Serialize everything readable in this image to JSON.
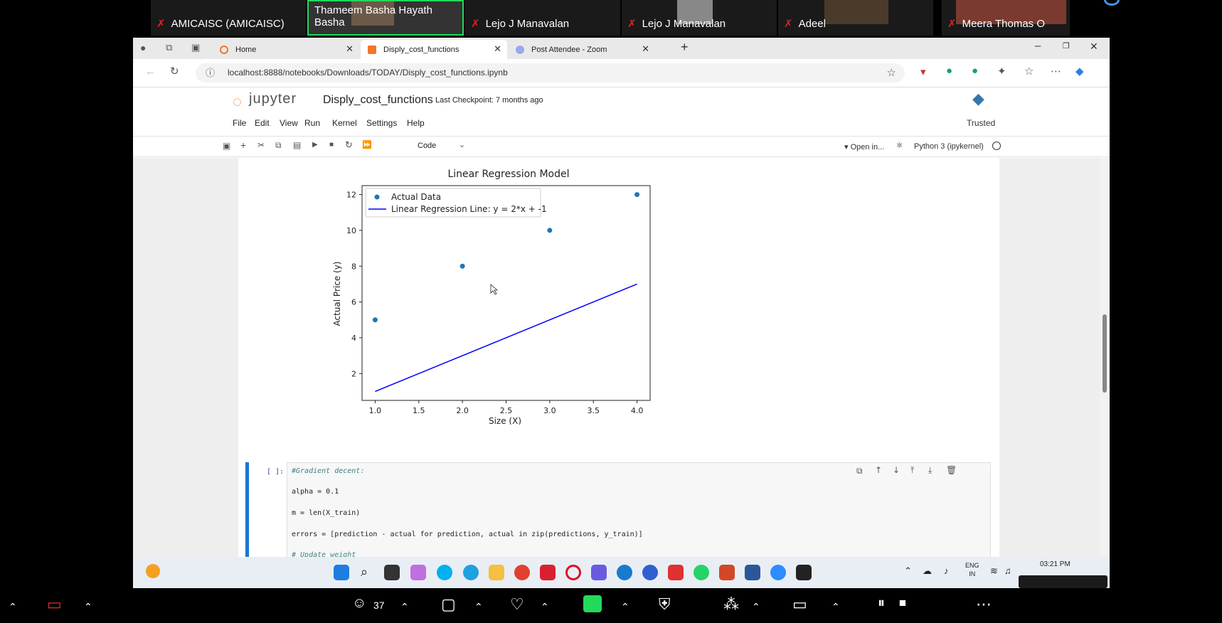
{
  "zoom": {
    "participants": [
      {
        "name": "AMICAISC (AMICAISC)",
        "muted": true
      },
      {
        "name": "Thameem Basha Hayath Basha",
        "muted": false,
        "active": true
      },
      {
        "name": "Lejo J Manavalan",
        "muted": true
      },
      {
        "name": "Lejo J Manavalan",
        "muted": true
      },
      {
        "name": "Adeel",
        "muted": true
      },
      {
        "name": "Meera Thomas O",
        "muted": true
      }
    ],
    "participants_count": "37"
  },
  "browser": {
    "tabs": [
      {
        "label": "Home"
      },
      {
        "label": "Disply_cost_functions"
      },
      {
        "label": "Post Attendee - Zoom"
      }
    ],
    "url": "localhost:8888/notebooks/Downloads/TODAY/Disply_cost_functions.ipynb"
  },
  "jupyter": {
    "logo_text": "jupyter",
    "notebook_title": "Disply_cost_functions",
    "checkpoint": "Last Checkpoint: 7 months ago",
    "trusted": "Trusted",
    "menu": [
      "File",
      "Edit",
      "View",
      "Run",
      "Kernel",
      "Settings",
      "Help"
    ],
    "cell_type": "Code",
    "open_in": "Open in...",
    "kernel": "Python 3 (ipykernel)",
    "cell_prompt": "[ ]:",
    "code_lines": [
      "#Gradient decent:",
      "alpha = 0.1",
      "m = len(X_train)",
      "errors = [prediction - actual for prediction, actual in zip(predictions, y_train)]",
      "# Update weight"
    ]
  },
  "chart_data": {
    "type": "scatter",
    "title": "Linear Regression Model",
    "xlabel": "Size (X)",
    "ylabel": "Actual Price (y)",
    "xlim": [
      0.85,
      4.15
    ],
    "ylim": [
      0.5,
      12.5
    ],
    "xticks": [
      "1.0",
      "1.5",
      "2.0",
      "2.5",
      "3.0",
      "3.5",
      "4.0"
    ],
    "yticks": [
      "2",
      "4",
      "6",
      "8",
      "10",
      "12"
    ],
    "series": [
      {
        "name": "Actual Data",
        "kind": "scatter",
        "color": "#1f77b4",
        "x": [
          1,
          2,
          3,
          4
        ],
        "y": [
          5,
          8,
          10,
          12
        ]
      },
      {
        "name": "Linear Regression Line: y = 2*x + -1",
        "kind": "line",
        "color": "#0000ff",
        "x": [
          1,
          4
        ],
        "y": [
          1,
          7
        ]
      }
    ],
    "legend_position": "top-left"
  },
  "taskbar": {
    "lang": "ENG",
    "region": "IN",
    "time": "03:21 PM"
  }
}
